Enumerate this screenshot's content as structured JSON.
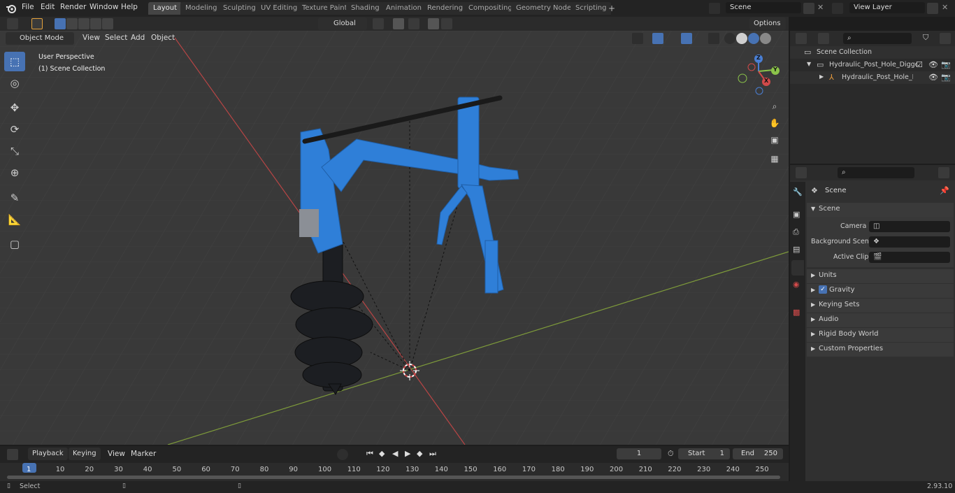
{
  "topbar": {
    "menus": [
      "File",
      "Edit",
      "Render",
      "Window",
      "Help"
    ],
    "workspaces": [
      "Layout",
      "Modeling",
      "Sculpting",
      "UV Editing",
      "Texture Paint",
      "Shading",
      "Animation",
      "Rendering",
      "Compositing",
      "Geometry Nodes",
      "Scripting"
    ],
    "active_workspace": "Layout",
    "add_workspace": "+",
    "scene_name": "Scene",
    "view_layer": "View Layer"
  },
  "viewport": {
    "mode": "Object Mode",
    "menus": [
      "View",
      "Select",
      "Add",
      "Object"
    ],
    "transform_orientation": "Global",
    "options_label": "Options",
    "overlay_line1": "User Perspective",
    "overlay_line2": "(1) Scene Collection",
    "gizmo_axes": [
      "Z",
      "Y",
      "X"
    ]
  },
  "outliner": {
    "root": "Scene Collection",
    "collection": "Hydraulic_Post_Hole_Digger_(",
    "object": "Hydraulic_Post_Hole_Digg"
  },
  "properties": {
    "header": "Scene",
    "section": "Scene",
    "fields": [
      {
        "label": "Camera"
      },
      {
        "label": "Background Scene"
      },
      {
        "label": "Active Clip"
      }
    ],
    "panels": [
      "Units",
      "Gravity",
      "Keying Sets",
      "Audio",
      "Rigid Body World",
      "Custom Properties"
    ],
    "gravity_checked": true
  },
  "timeline": {
    "menus": [
      "Playback",
      "Keying",
      "View",
      "Marker"
    ],
    "current_frame": "1",
    "start_label": "Start",
    "start_value": "1",
    "end_label": "End",
    "end_value": "250",
    "ruler": [
      "1",
      "10",
      "20",
      "30",
      "40",
      "50",
      "60",
      "70",
      "80",
      "90",
      "100",
      "110",
      "120",
      "130",
      "140",
      "150",
      "160",
      "170",
      "180",
      "190",
      "200",
      "210",
      "220",
      "230",
      "240",
      "250"
    ]
  },
  "status": {
    "left": "Select",
    "version": "2.93.10"
  },
  "colors": {
    "accent": "#4772b3",
    "x_axis": "#d24a4a",
    "y_axis": "#8bc34a",
    "model_blue": "#2f7fd8"
  }
}
